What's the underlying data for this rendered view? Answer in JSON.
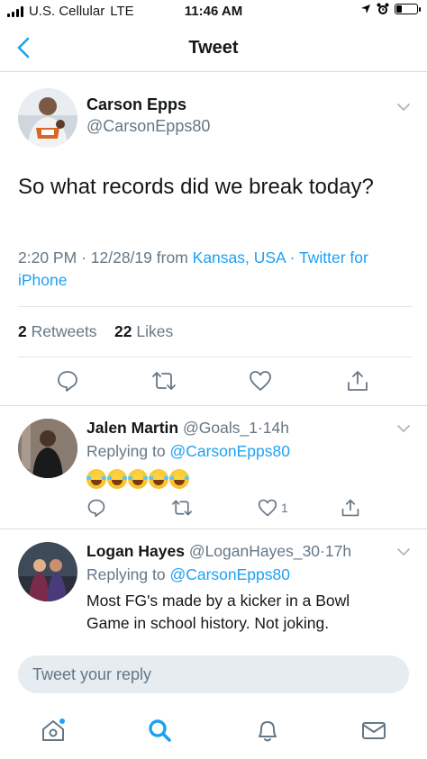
{
  "status_bar": {
    "carrier": "U.S. Cellular",
    "network": "LTE",
    "time": "11:46 AM",
    "battery_level": 0.25
  },
  "nav": {
    "title": "Tweet",
    "back_icon": "chevron-left-icon"
  },
  "main_tweet": {
    "name": "Carson Epps",
    "handle": "@CarsonEpps80",
    "text": "So what records did we break today?",
    "time": "2:20 PM",
    "date": "12/28/19",
    "from_label": "from",
    "location": "Kansas, USA",
    "source": "Twitter for iPhone",
    "separator": "·",
    "retweet_count": "2",
    "retweet_label": "Retweets",
    "like_count": "22",
    "like_label": "Likes"
  },
  "replies": [
    {
      "name": "Jalen Martin",
      "handle": "@Goals_1",
      "age": "14h",
      "replying_label": "Replying to",
      "replying_to": "@CarsonEpps80",
      "emoji_count": 5,
      "emoji": "face-with-tears-of-joy",
      "like_count": "1"
    },
    {
      "name": "Logan Hayes",
      "handle": "@LoganHayes_30",
      "age": "17h",
      "replying_label": "Replying to",
      "replying_to": "@CarsonEpps80",
      "text": "Most FG's made by a kicker in a Bowl Game in school history. Not joking."
    }
  ],
  "reply_bar": {
    "placeholder": "Tweet your reply"
  },
  "tab_bar": {
    "items": [
      "home-icon",
      "search-icon",
      "notifications-icon",
      "messages-icon"
    ],
    "active": "search-icon"
  },
  "colors": {
    "accent": "#1da1f2",
    "muted": "#657786",
    "divider": "#e1e8ed",
    "input_bg": "#e6ecf0"
  }
}
